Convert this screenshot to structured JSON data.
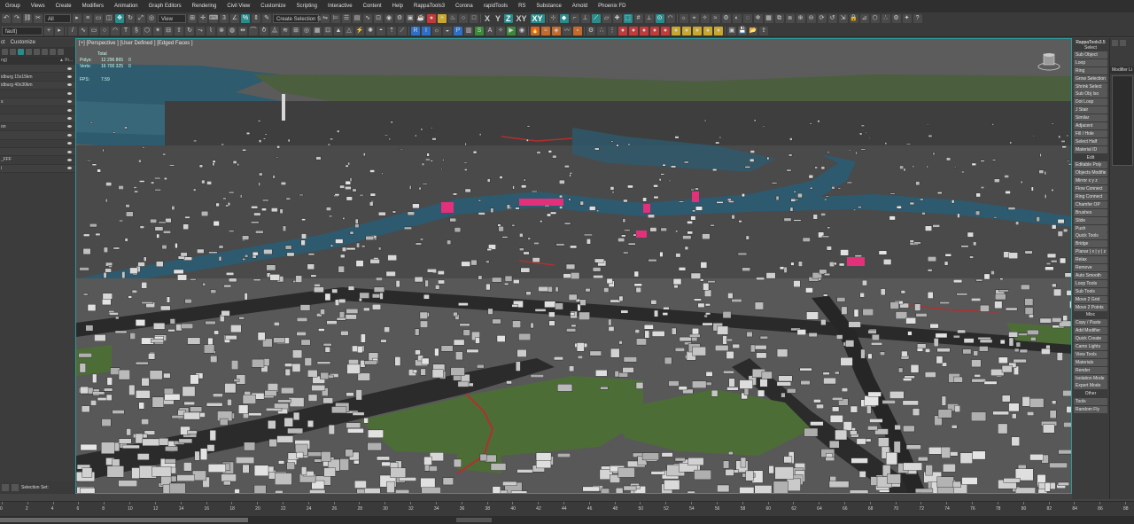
{
  "menu": [
    "Group",
    "Views",
    "Create",
    "Modifiers",
    "Animation",
    "Graph Editors",
    "Rendering",
    "Civil View",
    "Customize",
    "Scripting",
    "Interactive",
    "Content",
    "Help",
    "RappaTools3",
    "Corona",
    "rapidTools",
    "RS",
    "Substance",
    "Arnold",
    "Phoenix FD"
  ],
  "toolbar": {
    "filter_value": "All",
    "view_value": "View",
    "selection_set_value": "Create Selection Se",
    "axis_x": "X",
    "axis_y": "Y",
    "axis_z": "Z",
    "axis_xy": "XY",
    "axis_xy2": "XY",
    "layer_value": "fault)"
  },
  "explorer": {
    "tabs": [
      "ct",
      "Customize"
    ],
    "col_name": "ng)",
    "col_frozen": "▲ Fr...",
    "rows": [
      "",
      "idburg 15x15km",
      "idburg 40x30km",
      "",
      "s",
      "",
      "",
      "on",
      "",
      "",
      "",
      "_FFF",
      "i"
    ]
  },
  "viewport": {
    "label": "[+] [Perspective ] [User Defined ] [Edged Faces ]",
    "stats_total_label": "Total",
    "polys_label": "Polys:",
    "polys_value": "12 296 865",
    "verts_label": "Verts:",
    "verts_value": "16 700 325",
    "fps_label": "FPS:",
    "fps_value": "7.59",
    "polys_sel": "0",
    "verts_sel": "0"
  },
  "rappa": {
    "title": "RappaTools3.5",
    "subtitle": "Select",
    "buttons": [
      "Sub Object",
      "Loop",
      "Ring",
      "Grow Selection",
      "Shrink Select",
      "Sub Obj Iso",
      "Dot Loop",
      "J Stair",
      "Similar",
      "Adjacent",
      "Fill / Hole",
      "Select Half",
      "Material ID",
      "Edit",
      "Editable Poly",
      "Objects Modifie",
      "Mirror x y z",
      "Flow Connect",
      "Ring Connect",
      "Chamfer OP",
      "Brushes",
      "Slide",
      "Push",
      "Quick Tools",
      "Bridge",
      "Planar | x | y | z",
      "Relax",
      "Remove",
      "Auto Smooth",
      "Loop Tools",
      "Sub Tools",
      "Move 2 Grid",
      "Move 2 Points",
      "Misc",
      "Copy / Paste",
      "Add Modifier",
      "Quick Create",
      "Camo Lights",
      "View Tools",
      "Materials",
      "Render",
      "Isolation Mode",
      "Expert Mode",
      "Other",
      "Tools",
      "Random Fly"
    ]
  },
  "cmdpanel": {
    "modifier_label": "Modifier Li"
  },
  "status": {
    "selection_set_label": "Selection Set:"
  },
  "timeline": {
    "ticks": [
      "0",
      "2",
      "4",
      "6",
      "8",
      "10",
      "12",
      "14",
      "16",
      "18",
      "20",
      "22",
      "24",
      "26",
      "28",
      "30",
      "32",
      "34",
      "36",
      "38",
      "40",
      "42",
      "44",
      "46",
      "48",
      "50",
      "52",
      "54",
      "56",
      "58",
      "60",
      "62",
      "64",
      "66",
      "68",
      "70",
      "72",
      "74",
      "76",
      "78",
      "80",
      "82",
      "84",
      "86",
      "88"
    ]
  },
  "colors": {
    "accent": "#2b9a9a",
    "highlight_pink": "#e2307a",
    "river": "#2d5a6e",
    "park": "#4d6d36"
  }
}
